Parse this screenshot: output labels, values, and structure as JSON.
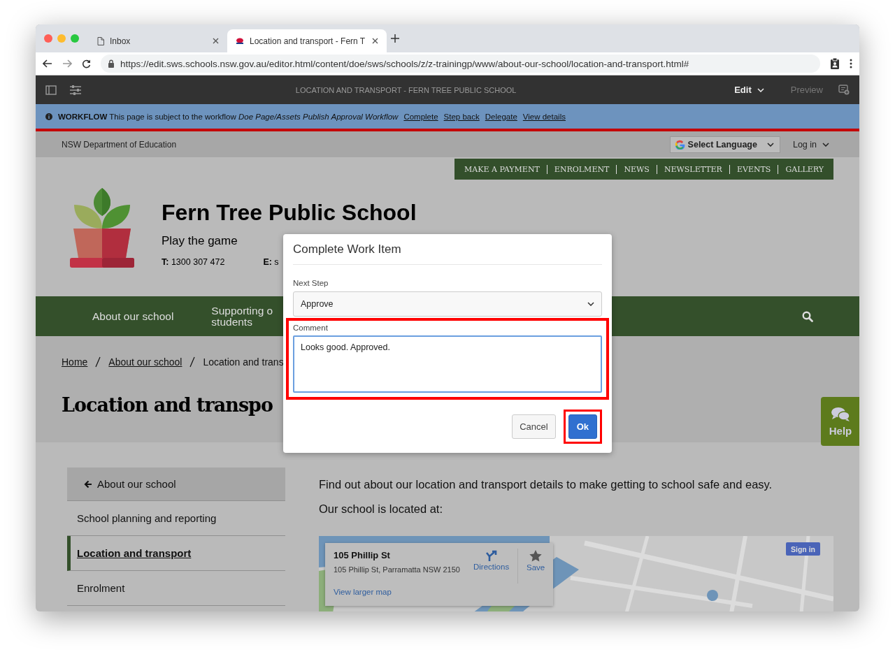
{
  "browser": {
    "tabs": [
      {
        "title": "Inbox",
        "selected": false
      },
      {
        "title": "Location and transport - Fern T",
        "selected": true
      }
    ],
    "url": "https://edit.sws.schools.nsw.gov.au/editor.html/content/doe/sws/schools/z/z-trainingp/www/about-our-school/location-and-transport.html#"
  },
  "editor_toolbar": {
    "page_title": "LOCATION AND TRANSPORT - FERN TREE PUBLIC SCHOOL",
    "mode": "Edit",
    "preview": "Preview"
  },
  "workflow_bar": {
    "message": "**WORKFLOW** This page is subject to the workflow *Doe Page/Assets Publish Approval Workflow*",
    "links": [
      "Complete",
      "Step back",
      "Delegate",
      "View details"
    ]
  },
  "site": {
    "utility": {
      "org": "NSW Department of Education",
      "language": "Select Language",
      "login": "Log in"
    },
    "top_links": [
      "MAKE A PAYMENT",
      "ENROLMENT",
      "NEWS",
      "NEWSLETTER",
      "EVENTS",
      "GALLERY"
    ],
    "school_name": "Fern Tree Public School",
    "motto": "Play the game",
    "contacts": [
      "**T:** 1300 307 472",
      "**E:** s"
    ],
    "main_nav": [
      {
        "lines": [
          "About our school"
        ]
      },
      {
        "lines": [
          "Supporting o",
          "students"
        ]
      }
    ],
    "breadcrumbs": [
      {
        "label": "Home",
        "link": true
      },
      {
        "label": "About our school",
        "link": true
      },
      {
        "label": "Location and trans",
        "link": false
      }
    ],
    "page_title": "Location and transpo",
    "side_nav": {
      "back": "About our school",
      "items": [
        {
          "label": "School planning and reporting",
          "selected": false
        },
        {
          "label": "Location and transport",
          "selected": true
        },
        {
          "label": "Enrolment",
          "selected": false
        }
      ]
    },
    "intro": "Find out about our location and transport details to make getting to school safe and easy.",
    "located": "Our school is located at:",
    "map": {
      "kind": "picture",
      "place_card": {
        "name": "105 Phillip St",
        "address": "105 Phillip St, Parramatta NSW 2150",
        "directions": "Directions",
        "save": "Save",
        "larger_map": "View larger map"
      },
      "sign_in": "Sign in"
    },
    "help": "Help"
  },
  "dialog": {
    "title": "Complete Work Item",
    "next_step_label": "Next Step",
    "next_step": "Approve",
    "comment_label": "Comment",
    "comment": "Looks good. Approved.",
    "comment_highlighted": true,
    "buttons": [
      {
        "label": "Cancel",
        "kind": "secondary",
        "highlighted": false
      },
      {
        "label": "Ok",
        "kind": "primary",
        "highlighted": true
      }
    ]
  }
}
